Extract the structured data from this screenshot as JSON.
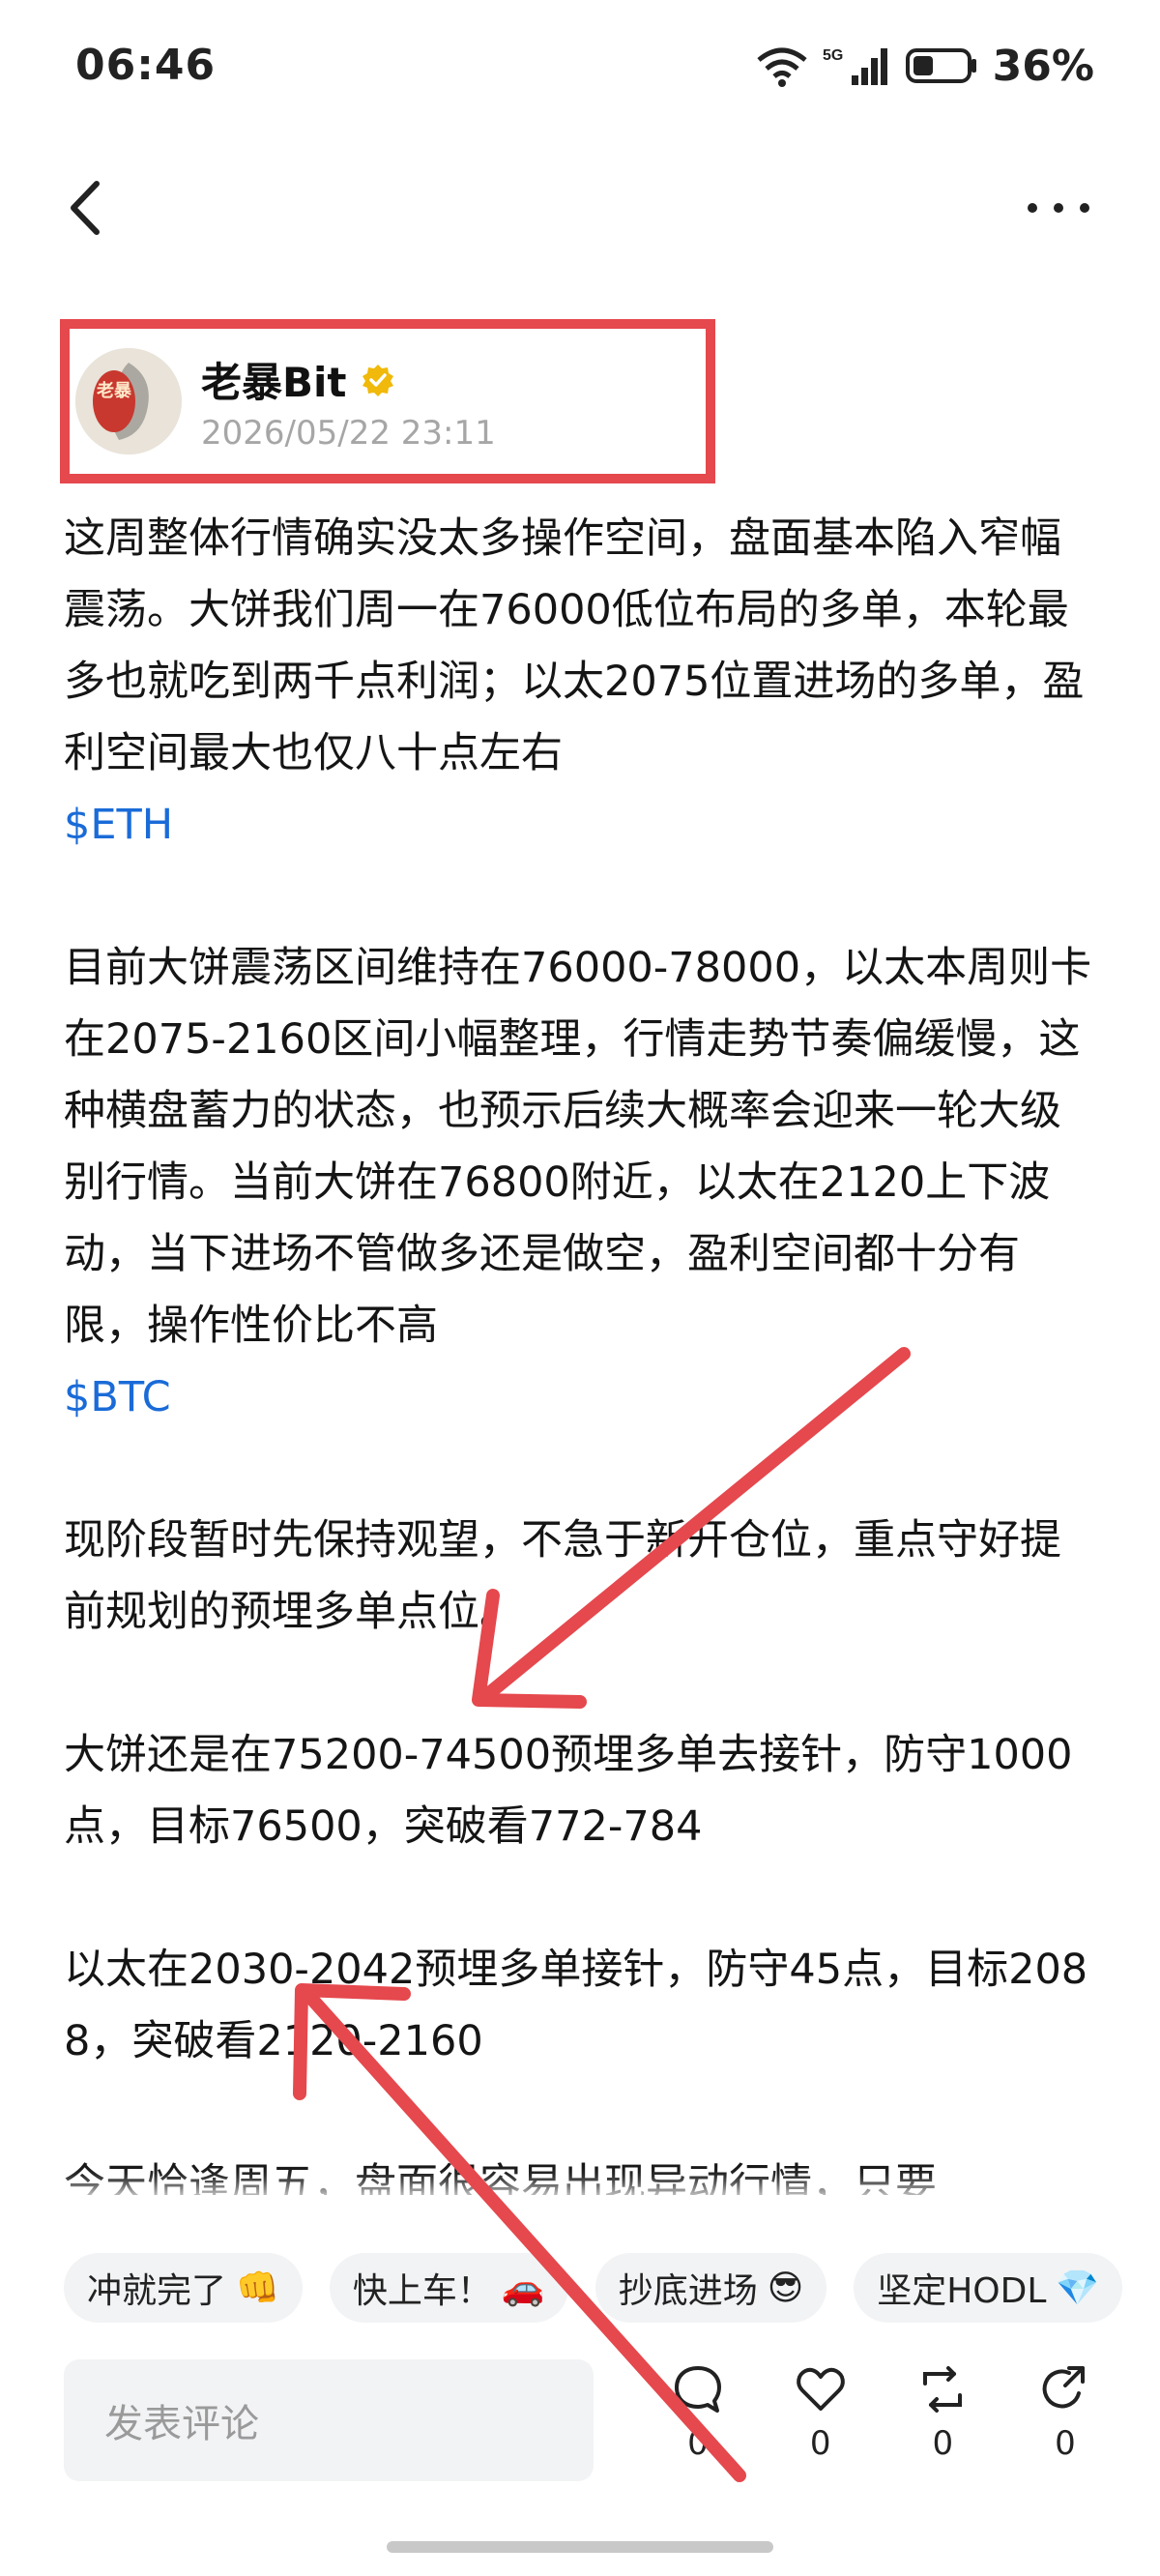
{
  "status_bar": {
    "time": "06:46",
    "battery": "36%",
    "network": "5G"
  },
  "nav": {
    "back_icon": "chevron-left-icon",
    "more_icon": "more-horizontal-icon"
  },
  "author": {
    "name": "老暴Bit",
    "date": "2026/05/22 23:11",
    "avatar_text": "老暴",
    "verified_color": "#f0b90b"
  },
  "article": {
    "p1": "这周整体行情确实没太多操作空间，盘面基本陷入窄幅震荡。大饼我们周一在76000低位布局的多单，本轮最多也就吃到两千点利润；以太2075位置进场的多单，盈利空间最大也仅八十点左右",
    "tag1": "$ETH",
    "p2": "目前大饼震荡区间维持在76000-78000，以太本周则卡在2075-2160区间小幅整理，行情走势节奏偏缓慢，这种横盘蓄力的状态，也预示后续大概率会迎来一轮大级别行情。当前大饼在76800附近，以太在2120上下波动，当下进场不管做多还是做空，盈利空间都十分有限，操作性价比不高",
    "tag2": "$BTC",
    "p3": "现阶段暂时先保持观望，不急于新开仓位，重点守好提前规划的预埋多单点位。",
    "p4": "大饼还是在75200-74500预埋多单去接针，防守1000点，目标76500，突破看772-784",
    "p5": "以太在2030-2042预埋多单接针，防守45点，目标2088，突破看2120-2160",
    "p6": "今天恰逢周五，盘面很容易出现异动行情，只要"
  },
  "reactions": [
    {
      "label": "冲就完了",
      "emoji": "👊"
    },
    {
      "label": "快上车！",
      "emoji": "🚗"
    },
    {
      "label": "抄底进场",
      "emoji": "😎"
    },
    {
      "label": "坚定HODL",
      "emoji": "💎"
    }
  ],
  "comment": {
    "placeholder": "发表评论"
  },
  "actions": {
    "comment_count": "0",
    "like_count": "0",
    "repost_count": "0",
    "share_count": "0"
  },
  "colors": {
    "tag_link": "#1a6bd8",
    "annotation": "#e5484d"
  }
}
